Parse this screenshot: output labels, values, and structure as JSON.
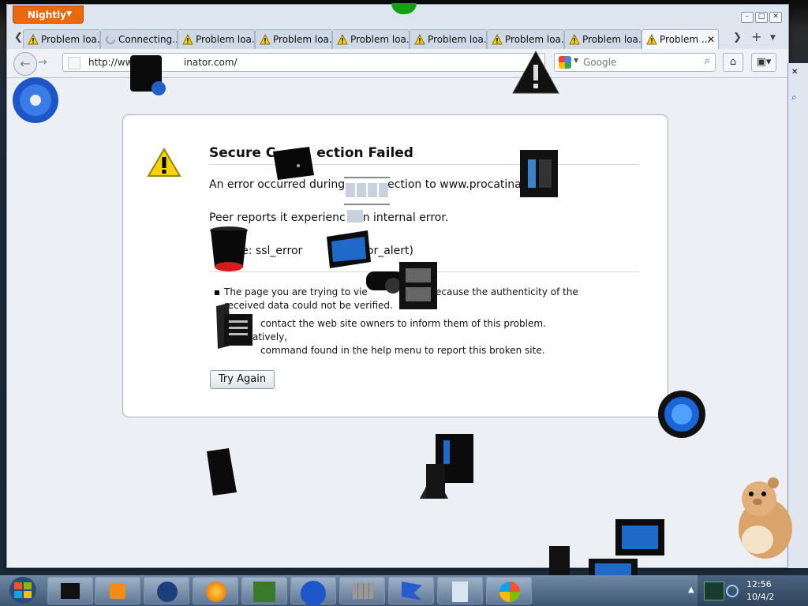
{
  "browser": {
    "app_menu_label": "Nightly",
    "tabs": [
      {
        "label": "Problem loa...",
        "icon": "warning-icon"
      },
      {
        "label": "Connecting...",
        "icon": "loading-icon"
      },
      {
        "label": "Problem loa...",
        "icon": "warning-icon"
      },
      {
        "label": "Problem loa...",
        "icon": "warning-icon"
      },
      {
        "label": "Problem loa...",
        "icon": "warning-icon"
      },
      {
        "label": "Problem loa...",
        "icon": "warning-icon"
      },
      {
        "label": "Problem loa...",
        "icon": "warning-icon"
      },
      {
        "label": "Problem loa...",
        "icon": "warning-icon"
      },
      {
        "label": "Problem ...",
        "icon": "warning-icon",
        "active": true
      }
    ],
    "new_tab_label": "+",
    "url": "http://www.procrastinator.com/",
    "url_visible": "http://www.",
    "url_visible_tail": "inator.com/",
    "search_placeholder": "Google"
  },
  "error_page": {
    "title": "Secure Connection Failed",
    "title_visible_a": "Secure C",
    "title_visible_b": "ection Failed",
    "line1_a": "An error occurred during",
    "line1_b": "ection to www.procatina",
    "line1_c": ".",
    "line2_a": "Peer reports it experienc",
    "line2_b": "n internal error.",
    "line3_a": "code: ssl_error",
    "line3_b": "error_alert)",
    "bullet1_a": "The page you are trying to vie",
    "bullet1_b": "own because the authenticity of the",
    "bullet1_c": "received data could not be verified.",
    "bullet2_a": "contact the web site owners to inform them of this problem. Alternatively,",
    "bullet2_b": "command found in the help menu to report this broken site.",
    "try_again_label": "Try Again"
  },
  "taskbar": {
    "time": "12:56",
    "date": "10/4/2"
  },
  "colors": {
    "app_button": "#e86a0c",
    "warning_yellow": "#f5d20a",
    "desktop_bg": "#1a2a38"
  }
}
